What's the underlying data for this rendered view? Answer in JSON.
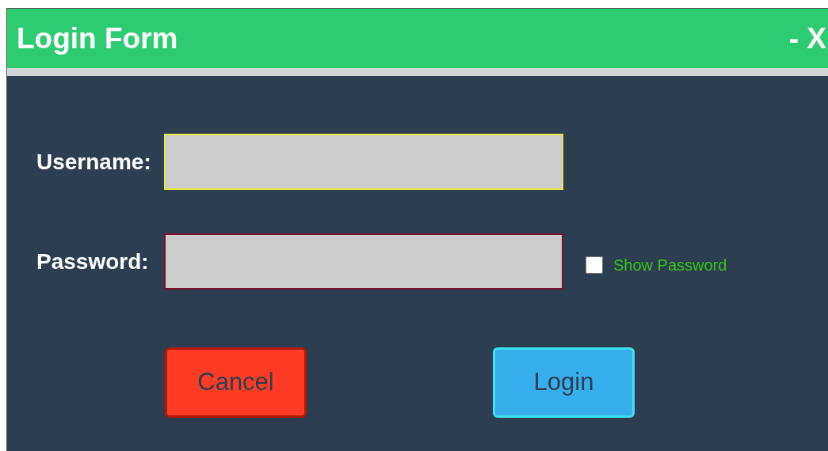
{
  "window": {
    "title": "Login Form",
    "controls": "- X"
  },
  "fields": [
    {
      "label": "Username:",
      "kind": "text"
    },
    {
      "label": "Password:",
      "kind": "password"
    }
  ],
  "show_password": {
    "label": "Show Password",
    "checked": false
  },
  "buttons": [
    {
      "label": "Cancel",
      "kind": "cancel"
    },
    {
      "label": "Login",
      "kind": "primary"
    }
  ]
}
